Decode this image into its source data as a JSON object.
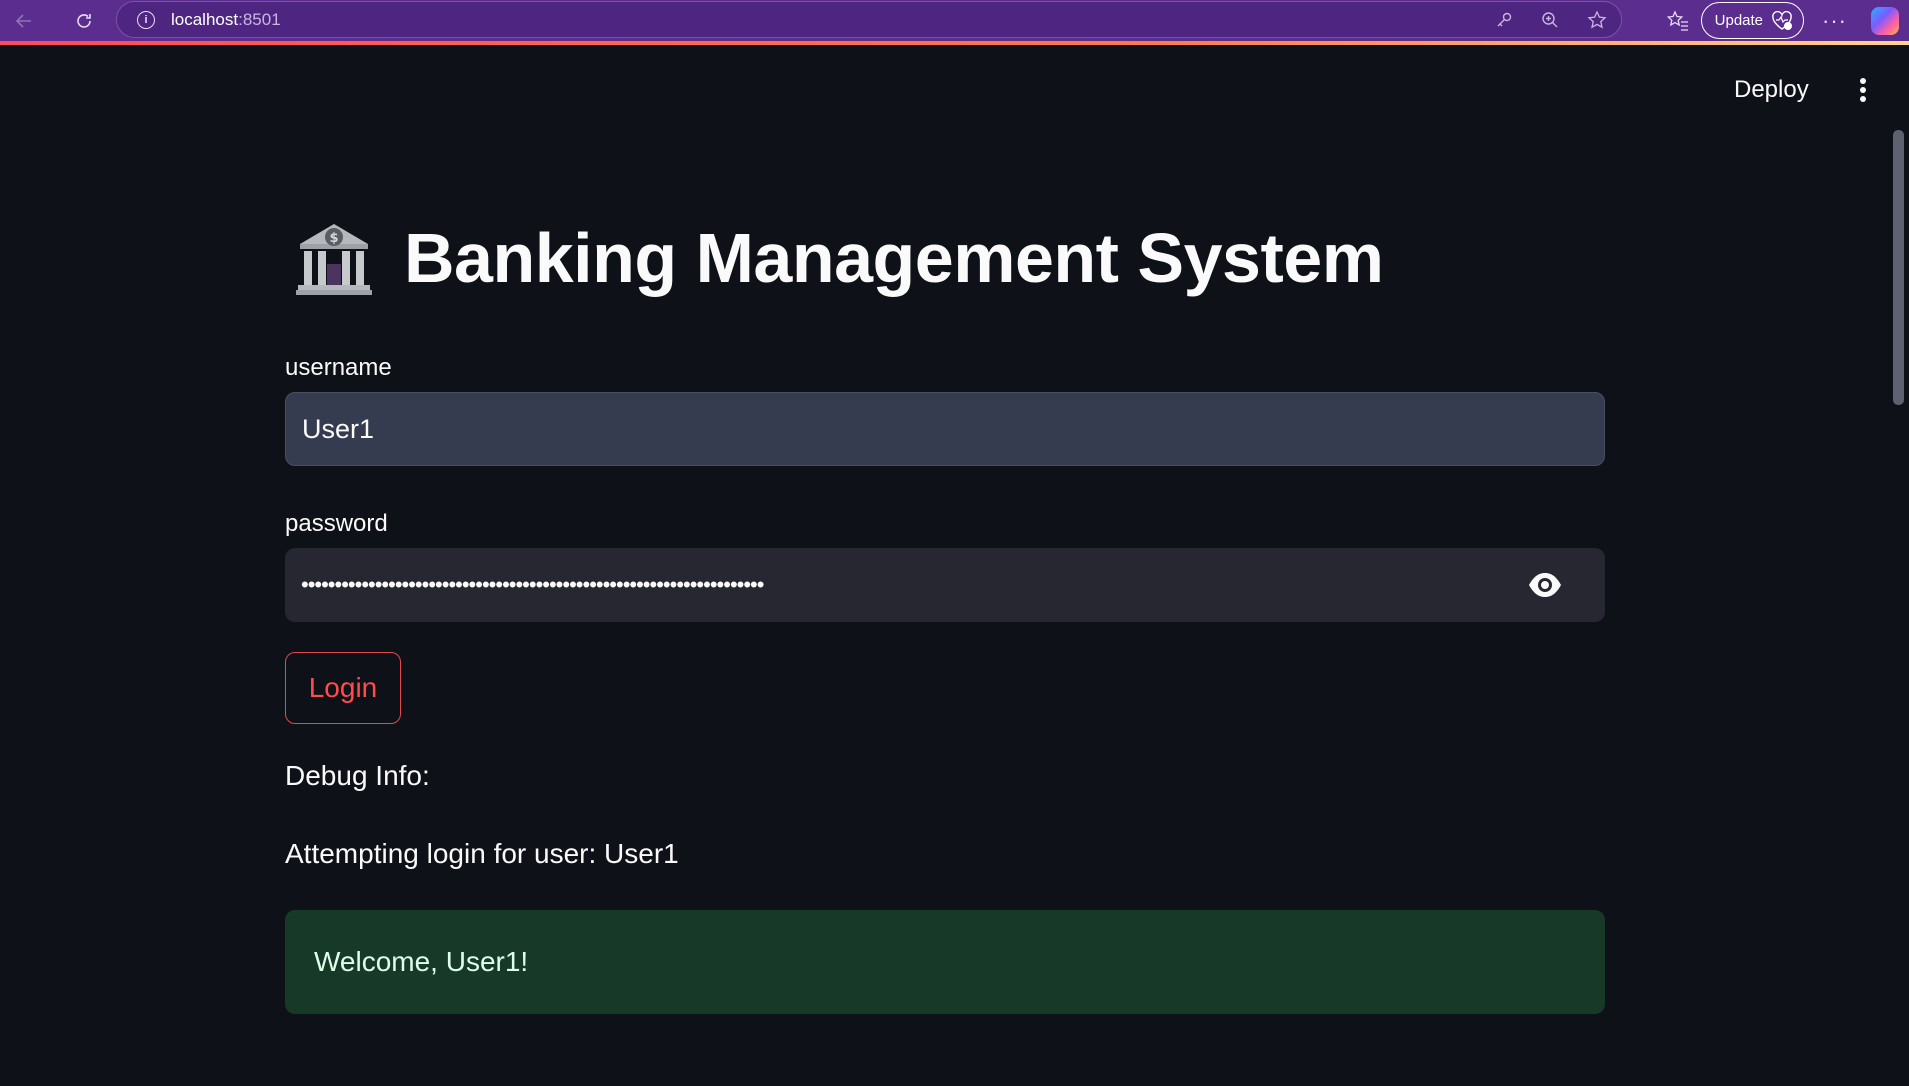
{
  "browser": {
    "url_host": "localhost",
    "url_port": ":8501",
    "update_label": "Update"
  },
  "app": {
    "deploy_label": "Deploy",
    "title": "Banking Management System",
    "title_icon": "bank-icon",
    "form": {
      "username_label": "username",
      "username_value": "User1",
      "password_label": "password",
      "password_value": "•••••••••••••••••••••••••••••••••••••••••••••••••••••••••••••••••••••",
      "login_label": "Login"
    },
    "debug_heading": "Debug Info:",
    "attempt_text": "Attempting login for user: User1",
    "success_message": "Welcome, User1!"
  },
  "colors": {
    "background": "#0e1117",
    "accent": "#ff4b4b",
    "success_bg": "#173928",
    "browser_frame": "#5b2d8e"
  }
}
